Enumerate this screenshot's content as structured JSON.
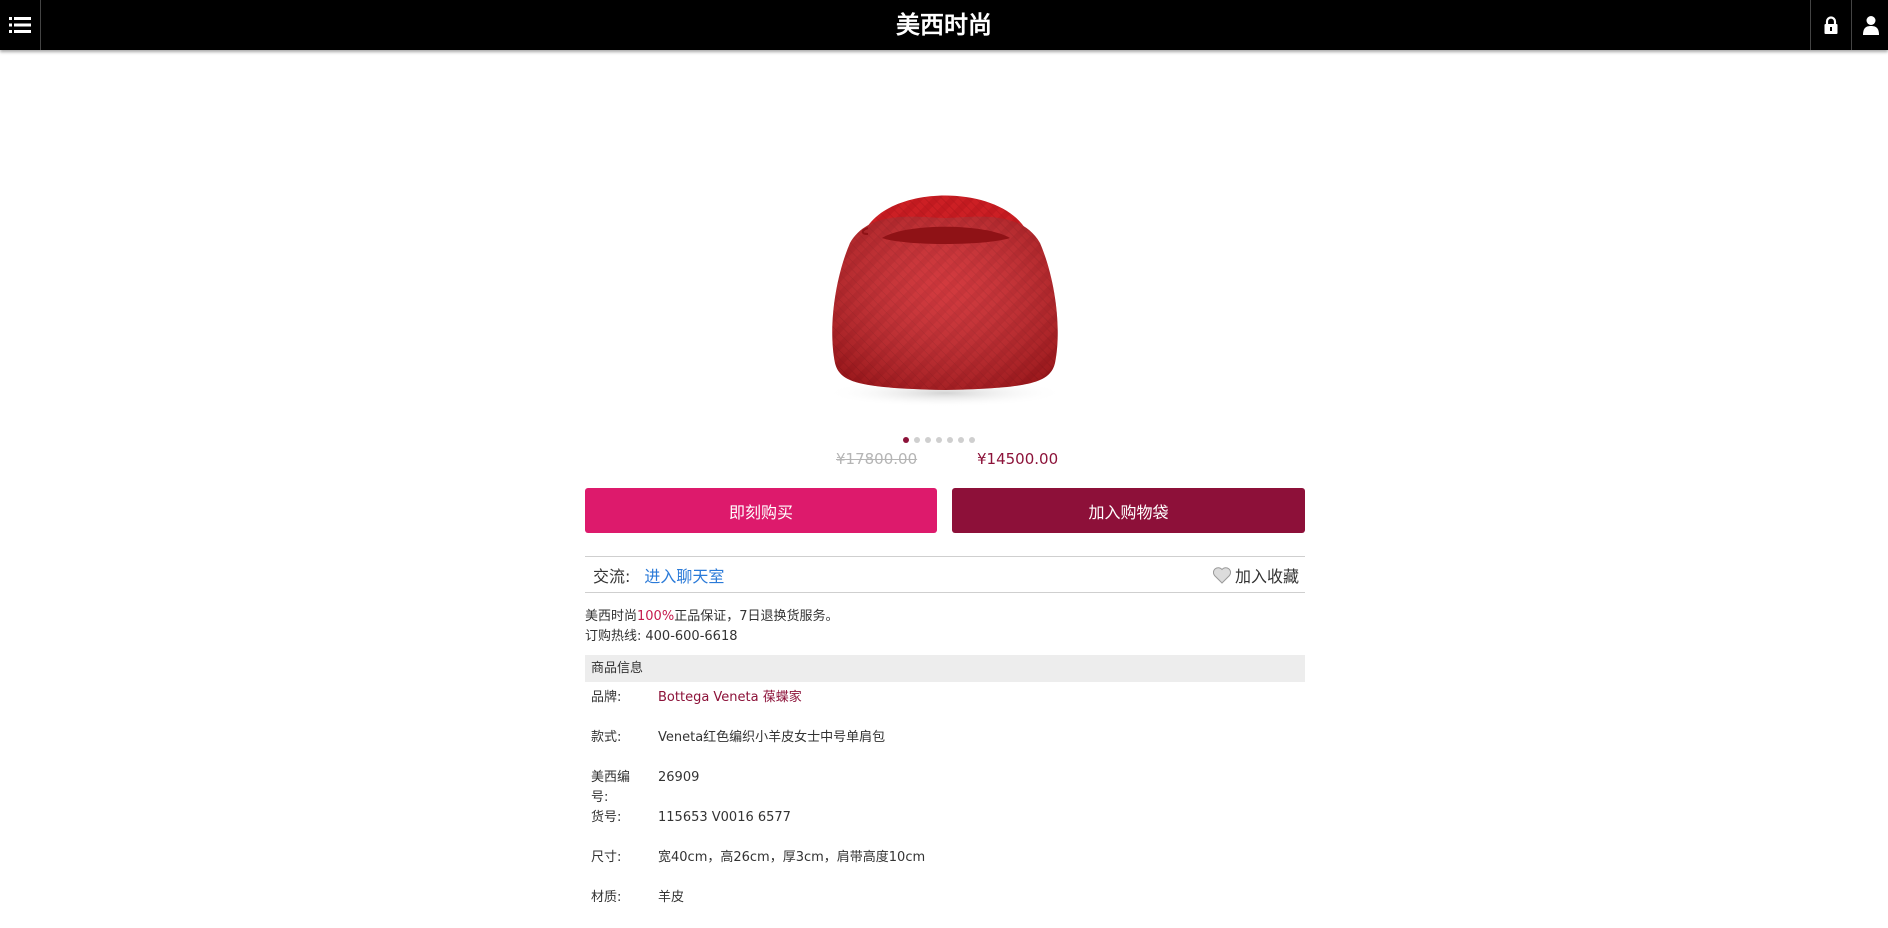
{
  "header": {
    "title": "美西时尚",
    "menu_icon": "list-menu-icon",
    "lock_icon": "lock-icon",
    "user_icon": "user-icon"
  },
  "product": {
    "image": "red-woven-hobo-bag",
    "carousel": {
      "total": 7,
      "active": 1
    },
    "price_original": "¥17800.00",
    "price_sale": "¥14500.00"
  },
  "actions": {
    "buy_now": "即刻购买",
    "add_to_bag": "加入购物袋"
  },
  "chat": {
    "label": "交流:",
    "link": "进入聊天室",
    "favorite": "加入收藏"
  },
  "guarantee": {
    "prefix": "美西时尚",
    "highlight": "100%",
    "suffix": "正品保证，7日退换货服务。",
    "hotline_label": "订购热线:",
    "hotline": "400-600-6618"
  },
  "info": {
    "section_title": "商品信息",
    "rows": [
      {
        "label": "品牌:",
        "value": "Bottega Veneta 葆蝶家"
      },
      {
        "label": "款式:",
        "value": "Veneta红色编织小羊皮女士中号单肩包"
      },
      {
        "label": "美西编号:",
        "value": "26909"
      },
      {
        "label": "货号:",
        "value": "115653 V0016 6577"
      },
      {
        "label": "尺寸:",
        "value": "宽40cm，高26cm，厚3cm，肩带高度10cm"
      },
      {
        "label": "材质:",
        "value": "羊皮"
      }
    ]
  },
  "colors": {
    "header_bg": "#000000",
    "buy_button": "#dd1a6c",
    "cart_button": "#8d1039",
    "price_sale": "#8c1239",
    "link": "#2a7ad8"
  }
}
